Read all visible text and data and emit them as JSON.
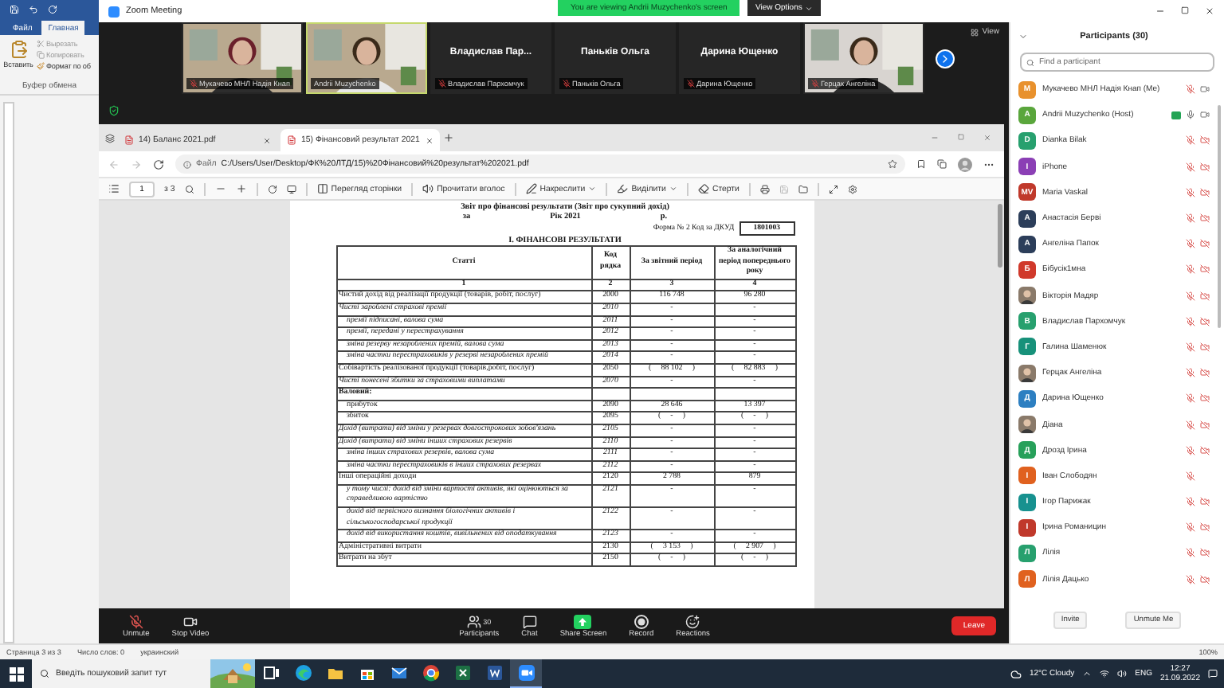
{
  "word": {
    "tabs": [
      {
        "label": "Файл",
        "selected": false
      },
      {
        "label": "Главная",
        "selected": true
      }
    ],
    "clipboard": {
      "paste": "Вставить",
      "cut": "Вырезать",
      "copy": "Копировать",
      "format": "Формат по об",
      "group": "Буфер обмена"
    },
    "status": [
      "Страница 3 из 3",
      "Число слов: 0",
      "украинский"
    ],
    "zoom_level": "100%"
  },
  "zoom": {
    "title": "Zoom Meeting",
    "banner": "You are viewing Andrii Muzychenko's screen",
    "view_options": "View Options",
    "view": "View",
    "tiles": [
      {
        "kind": "picture",
        "label": "Мукачево МНЛ Надія Кнап",
        "muted": true,
        "active": false
      },
      {
        "kind": "picture",
        "label": "Andrii Muzychenko",
        "muted": false,
        "active": true
      },
      {
        "kind": "name",
        "display_name": "Владислав  Пар...",
        "label": "Владислав Пархомчук",
        "muted": true,
        "active": false
      },
      {
        "kind": "name",
        "display_name": "Паньків Ольга",
        "label": "Паньків Ольга",
        "muted": true,
        "active": false
      },
      {
        "kind": "name",
        "display_name": "Дарина Ющенко",
        "label": "Дарина Ющенко",
        "muted": true,
        "active": false
      },
      {
        "kind": "picture",
        "label": "Герцак Ангеліна",
        "muted": true,
        "active": false
      }
    ],
    "toolbar": [
      {
        "kind": "mic",
        "label": "Unmute",
        "muted": true
      },
      {
        "kind": "video",
        "label": "Stop Video"
      },
      {
        "kind": "participants",
        "label": "Participants",
        "count": "30"
      },
      {
        "kind": "chat",
        "label": "Chat"
      },
      {
        "kind": "share",
        "label": "Share Screen"
      },
      {
        "kind": "record",
        "label": "Record"
      },
      {
        "kind": "reactions",
        "label": "Reactions"
      }
    ],
    "leave": "Leave"
  },
  "browser": {
    "tabs": [
      {
        "label": "14) Баланс 2021.pdf",
        "selected": false
      },
      {
        "label": "15) Фінансовий результат 2021",
        "selected": true
      }
    ],
    "address": {
      "scheme": "Файл",
      "url": "C:/Users/User/Desktop/ФК%20ЛТД/15)%20Фінансовий%20результат%202021.pdf"
    },
    "pdf_toolbar": {
      "page": "1",
      "of": "з 3",
      "tools": [
        {
          "kind": "page-view",
          "label": "Перегляд сторінки",
          "menu": false
        },
        {
          "kind": "read",
          "label": "Прочитати вголос",
          "menu": false
        },
        {
          "kind": "draw",
          "label": "Накреслити",
          "menu": true
        },
        {
          "kind": "highlight",
          "label": "Виділити",
          "menu": true
        },
        {
          "kind": "erase",
          "label": "Стерти",
          "menu": false
        }
      ]
    }
  },
  "document": {
    "title": "Звіт про фінансові результати (Звіт про сукупний дохід)",
    "period": [
      "за",
      "Рік 2021",
      "р."
    ],
    "form": "Форма № 2  Код за ДКУД",
    "form_code": "1801003",
    "section": "І. ФІНАНСОВІ РЕЗУЛЬТАТИ",
    "columns": [
      "Статті",
      "Код рядка",
      "За звітний період",
      "За аналогічний період попереднього року"
    ],
    "column_numbers": [
      "1",
      "2",
      "3",
      "4"
    ],
    "rows": [
      {
        "kind": "main",
        "label": "Чистий  дохід від реалізації продукції (товарів, робіт, послуг)",
        "code": "2000",
        "current": "116 748",
        "previous": "96 280"
      },
      {
        "kind": "italic",
        "label": "Чисті зароблені страхові премії",
        "code": "2010",
        "current": "-",
        "previous": "-"
      },
      {
        "kind": "sub",
        "label": "премії підписані, валова сума",
        "code": "2011",
        "current": "-",
        "previous": "-"
      },
      {
        "kind": "sub",
        "label": "премії, передані у перестрахування",
        "code": "2012",
        "current": "-",
        "previous": "-"
      },
      {
        "kind": "sub",
        "label": "зміна резерву незароблених премій, валова сума",
        "code": "2013",
        "current": "-",
        "previous": "-"
      },
      {
        "kind": "sub",
        "label": "зміна частки перестраховиків у резерві незароблених премій",
        "code": "2014",
        "current": "-",
        "previous": "-"
      },
      {
        "kind": "main",
        "label": "Собівартість реалізованої продукції (товарів,робіт, послуг)",
        "code": "2050",
        "current": "(     88 102     )",
        "previous": "(     82 883     )"
      },
      {
        "kind": "italic",
        "label": "Чисті понесені збитки за страховими виплатами",
        "code": "2070",
        "current": "-",
        "previous": "-"
      },
      {
        "kind": "heading",
        "label": "Валовий:"
      },
      {
        "kind": "indent",
        "label": "прибуток",
        "code": "2090",
        "current": "28 646",
        "previous": "13 397"
      },
      {
        "kind": "indent",
        "label": "збиток",
        "code": "2095",
        "current": "(     -     )",
        "previous": "(     -     )"
      },
      {
        "kind": "italic",
        "label": "Дохід (витрати) від зміни у резервах довгострокових зобов'язань",
        "code": "2105",
        "current": "-",
        "previous": "-"
      },
      {
        "kind": "italic",
        "label": "Дохід (витрати) від зміни інших страхових резервів",
        "code": "2110",
        "current": "-",
        "previous": "-"
      },
      {
        "kind": "sub",
        "label": "зміна інших страхових резервів, валова сума",
        "code": "2111",
        "current": "-",
        "previous": "-"
      },
      {
        "kind": "sub",
        "label": "зміна частки перестраховиків в інших страхових резервах",
        "code": "2112",
        "current": "-",
        "previous": "-"
      },
      {
        "kind": "main",
        "label": "Інші операційні доходи",
        "code": "2120",
        "current": "2 788",
        "previous": "879"
      },
      {
        "kind": "sub",
        "label": "у тому числі: дохід від зміни вартості активів, які оцінюються за справедливою вартістю",
        "code": "2121",
        "current": "-",
        "previous": "-"
      },
      {
        "kind": "sub",
        "label": "дохід від первісного визнання біологічних активів і сільськогосподарської продукції",
        "code": "2122",
        "current": "-",
        "previous": "-"
      },
      {
        "kind": "sub",
        "label": "дохід від використання коштів, вивільнених від оподаткування",
        "code": "2123",
        "current": "-",
        "previous": "-"
      },
      {
        "kind": "main",
        "label": "Адміністративні витрати",
        "code": "2130",
        "current": "(     3 153     )",
        "previous": "(     2 907     )"
      },
      {
        "kind": "main",
        "label": "Витрати на збут",
        "code": "2150",
        "current": "(     -     )",
        "previous": "(     -     )"
      }
    ]
  },
  "participants": {
    "title": "Participants (30)",
    "search": {
      "placeholder": "Find a participant"
    },
    "list": [
      {
        "name": "Мукачево МНЛ Надія Кнап (Me)",
        "initials": "M",
        "color": "#e8912d",
        "muted": true,
        "camera_icon": true,
        "video_off": false,
        "sharing": false
      },
      {
        "name": "Andrii Muzychenko (Host)",
        "initials": "A",
        "color": "#5aa63c",
        "muted": false,
        "camera_icon": true,
        "video_off": false,
        "sharing": true
      },
      {
        "name": "Dianka Bilak",
        "initials": "D",
        "color": "#27a06e",
        "muted": true,
        "camera_icon": true,
        "video_off": true,
        "sharing": false
      },
      {
        "name": "iPhone",
        "initials": "I",
        "color": "#8b3fb5",
        "muted": true,
        "camera_icon": true,
        "video_off": true,
        "sharing": false
      },
      {
        "name": "Maria Vaskal",
        "initials": "MV",
        "color": "#c0392b",
        "muted": true,
        "camera_icon": true,
        "video_off": true,
        "sharing": false
      },
      {
        "name": "Анастасія Берві",
        "initials": "А",
        "color": "#2c3e5a",
        "muted": true,
        "camera_icon": true,
        "video_off": true,
        "sharing": false
      },
      {
        "name": "Ангеліна Папок",
        "initials": "А",
        "color": "#2c3e5a",
        "muted": true,
        "camera_icon": true,
        "video_off": true,
        "sharing": false
      },
      {
        "name": "Бібусік1мна",
        "initials": "Б",
        "color": "#d0392b",
        "muted": true,
        "camera_icon": true,
        "video_off": true,
        "sharing": false
      },
      {
        "name": "Вікторія Мадяр",
        "photo": true,
        "muted": true,
        "camera_icon": true,
        "video_off": true,
        "sharing": false
      },
      {
        "name": "Владислав Пархомчук",
        "initials": "В",
        "color": "#27a06e",
        "muted": true,
        "camera_icon": true,
        "video_off": true,
        "sharing": false
      },
      {
        "name": "Галина Шаменюк",
        "initials": "Г",
        "color": "#17917a",
        "muted": true,
        "camera_icon": true,
        "video_off": true,
        "sharing": false
      },
      {
        "name": "Герцак Ангеліна",
        "photo": true,
        "muted": true,
        "camera_icon": true,
        "video_off": true,
        "sharing": false
      },
      {
        "name": "Дарина Ющенко",
        "initials": "Д",
        "color": "#2d7fc1",
        "muted": true,
        "camera_icon": true,
        "video_off": true,
        "sharing": false
      },
      {
        "name": "Діана",
        "photo": true,
        "muted": true,
        "camera_icon": true,
        "video_off": true,
        "sharing": false
      },
      {
        "name": "Дрозд Ірина",
        "initials": "Д",
        "color": "#27a05a",
        "muted": true,
        "camera_icon": true,
        "video_off": true,
        "sharing": false
      },
      {
        "name": "Іван Слободян",
        "initials": "І",
        "color": "#e0611f",
        "muted": true,
        "camera_icon": false,
        "sharing": false
      },
      {
        "name": "Ігор Парижак",
        "initials": "І",
        "color": "#17918f",
        "muted": true,
        "camera_icon": true,
        "video_off": true,
        "sharing": false
      },
      {
        "name": "Ірина Романицин",
        "initials": "І",
        "color": "#c0392b",
        "muted": true,
        "camera_icon": true,
        "video_off": true,
        "sharing": false
      },
      {
        "name": "Лілія",
        "initials": "Л",
        "color": "#27a06e",
        "muted": true,
        "camera_icon": true,
        "video_off": true,
        "sharing": false
      },
      {
        "name": "Лілія Дацько",
        "initials": "Л",
        "color": "#e0611f",
        "muted": true,
        "camera_icon": true,
        "video_off": true,
        "sharing": false
      }
    ],
    "buttons": [
      "Invite",
      "Unmute Me"
    ]
  },
  "taskbar": {
    "search": {
      "placeholder": "Введіть пошуковий запит тут"
    },
    "apps": [
      {
        "kind": "task-view",
        "active": false
      },
      {
        "kind": "edge",
        "active": false
      },
      {
        "kind": "explorer",
        "active": false
      },
      {
        "kind": "store",
        "active": false
      },
      {
        "kind": "mail",
        "active": false
      },
      {
        "kind": "chrome",
        "active": false
      },
      {
        "kind": "excel",
        "active": false
      },
      {
        "kind": "word",
        "active": false
      },
      {
        "kind": "zoom",
        "active": true
      }
    ],
    "weather": "12°C Cloudy",
    "language": "ENG",
    "time": "12:27",
    "date": "21.09.2022"
  }
}
